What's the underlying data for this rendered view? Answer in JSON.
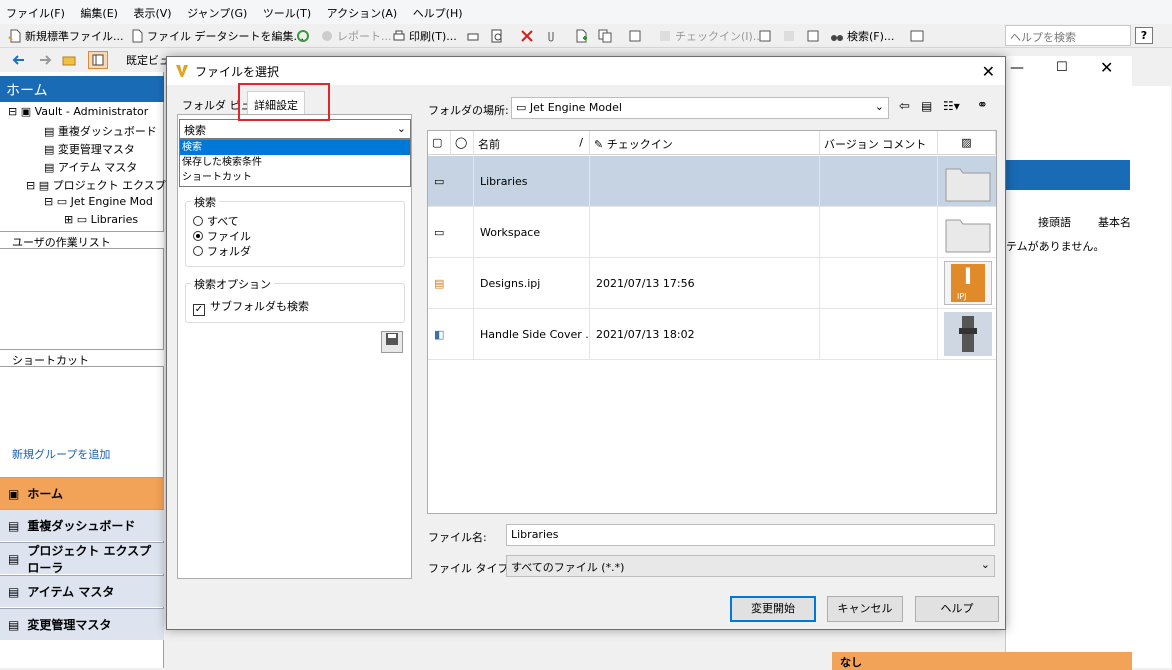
{
  "menu": [
    "ファイル(F)",
    "編集(E)",
    "表示(V)",
    "ジャンプ(G)",
    "ツール(T)",
    "アクション(A)",
    "ヘルプ(H)"
  ],
  "toolbar": {
    "new_std_file": "新規標準ファイル...",
    "file_datasheet": "ファイル データシートを編集...",
    "report": "レポート...",
    "print": "印刷(T)...",
    "checkin": "チェックイン(I)...",
    "search": "検索(F)...",
    "help_search_placeholder": "ヘルプを検索",
    "help_q": "?",
    "default_view": "既定ビュ"
  },
  "left": {
    "home_title": "ホーム",
    "tree": [
      "Vault - Administrator",
      "重複ダッシュボード",
      "変更管理マスタ",
      "アイテム マスタ",
      "プロジェクト エクスプロ",
      "Jet Engine Mod",
      "Libraries"
    ],
    "worklist": "ユーザの作業リスト",
    "shortcut": "ショートカット",
    "add_group": "新規グループを追加",
    "nav": [
      "ホーム",
      "重複ダッシュボード",
      "プロジェクト エクスプローラ",
      "アイテム マスタ",
      "変更管理マスタ"
    ]
  },
  "right_bg": {
    "prefix_col": "接頭語",
    "basic_col": "基本名",
    "no_items": "テムがありません。",
    "bottom": "なし"
  },
  "dialog": {
    "title": "ファイルを選択",
    "tabs": [
      "フォルダ ビュー",
      "詳細設定"
    ],
    "search_combo": "検索",
    "dropdown": [
      "検索",
      "保存した検索条件",
      "ショートカット"
    ],
    "search_group": "検索",
    "radios": [
      "すべて",
      "ファイル",
      "フォルダ"
    ],
    "options_group": "検索オプション",
    "subfolder": "サブフォルダも検索",
    "location_label": "フォルダの場所:",
    "location_value": "Jet Engine Model",
    "columns": [
      "名前",
      "チェックイン",
      "バージョン コメント"
    ],
    "rows": [
      {
        "name": "Libraries",
        "checkin": ""
      },
      {
        "name": "Workspace",
        "checkin": ""
      },
      {
        "name": "Designs.ipj",
        "checkin": "2021/07/13 17:56"
      },
      {
        "name": "Handle Side Cover ...",
        "checkin": "2021/07/13 18:02"
      }
    ],
    "filename_label": "ファイル名:",
    "filename_value": "Libraries",
    "filetype_label": "ファイル タイプ:",
    "filetype_value": "すべてのファイル (*.*)",
    "buttons": [
      "変更開始",
      "キャンセル",
      "ヘルプ"
    ],
    "ipj_badge": "IPJ"
  }
}
